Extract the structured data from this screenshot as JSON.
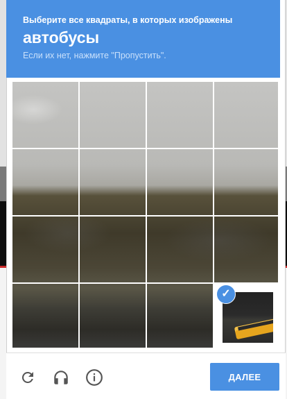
{
  "header": {
    "instruction": "Выберите все квадраты, в которых изображены",
    "object": "автобусы",
    "hint": "Если их нет, нажмите \"Пропустить\"."
  },
  "grid": {
    "rows": 4,
    "cols": 4,
    "selected": [
      [
        3,
        3
      ]
    ]
  },
  "footer": {
    "reload_icon": "reload-icon",
    "audio_icon": "headphones-icon",
    "info_icon": "info-icon",
    "next_label": "ДАЛЕЕ"
  },
  "colors": {
    "accent": "#4a90e2"
  }
}
